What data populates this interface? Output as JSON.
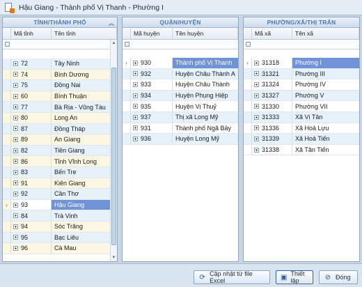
{
  "window": {
    "title": "Hậu Giang - Thành phố Vị Thanh - Phường I"
  },
  "provinces": {
    "title": "TỈNH/THÀNH PHỐ",
    "col_code": "Mã tỉnh",
    "col_name": "Tên tỉnh",
    "rows": [
      {
        "code": "72",
        "name": "Tây Ninh"
      },
      {
        "code": "74",
        "name": "Bình Dương"
      },
      {
        "code": "75",
        "name": "Đồng Nai"
      },
      {
        "code": "60",
        "name": "Bình Thuận"
      },
      {
        "code": "77",
        "name": "Bà Rịa - Vũng Tàu"
      },
      {
        "code": "80",
        "name": "Long An"
      },
      {
        "code": "87",
        "name": "Đồng Tháp"
      },
      {
        "code": "89",
        "name": "An Giang"
      },
      {
        "code": "82",
        "name": "Tiền Giang"
      },
      {
        "code": "86",
        "name": "Tỉnh  Vĩnh Long"
      },
      {
        "code": "83",
        "name": "Bến Tre"
      },
      {
        "code": "91",
        "name": "Kiên Giang"
      },
      {
        "code": "92",
        "name": "Cần Thơ"
      },
      {
        "code": "93",
        "name": "Hậu Giang"
      },
      {
        "code": "84",
        "name": "Trà Vinh"
      },
      {
        "code": "94",
        "name": "Sóc Trăng"
      },
      {
        "code": "95",
        "name": "Bạc Liêu"
      },
      {
        "code": "96",
        "name": "Cà Mau"
      }
    ]
  },
  "districts": {
    "title": "QUẬN/HUYỆN",
    "col_code": "Mã huyện",
    "col_name": "Tên huyện",
    "rows": [
      {
        "code": "930",
        "name": "Thành phố Vị Thanh"
      },
      {
        "code": "932",
        "name": "Huyện Châu Thành A"
      },
      {
        "code": "933",
        "name": "Huyện Châu Thành"
      },
      {
        "code": "934",
        "name": "Huyện Phụng Hiệp"
      },
      {
        "code": "935",
        "name": "Huyện Vị Thuỷ"
      },
      {
        "code": "937",
        "name": "Thị xã Long Mỹ"
      },
      {
        "code": "931",
        "name": "Thành phố Ngã Bảy"
      },
      {
        "code": "936",
        "name": "Huyện Long Mỹ"
      }
    ]
  },
  "wards": {
    "title": "PHƯỜNG/XÃ/THỊ TRẤN",
    "col_code": "Mã xã",
    "col_name": "Tên xã",
    "rows": [
      {
        "code": "31318",
        "name": "Phường I"
      },
      {
        "code": "31321",
        "name": "Phường III"
      },
      {
        "code": "31324",
        "name": "Phường IV"
      },
      {
        "code": "31327",
        "name": "Phường V"
      },
      {
        "code": "31330",
        "name": "Phường VII"
      },
      {
        "code": "31333",
        "name": "Xã Vị Tân"
      },
      {
        "code": "31336",
        "name": "Xã Hoả Lựu"
      },
      {
        "code": "31339",
        "name": "Xã Hoả Tiến"
      },
      {
        "code": "31338",
        "name": "Xã Tân Tiến"
      }
    ]
  },
  "buttons": {
    "update_excel": "Cập nhật từ file Excel",
    "setup": "Thiết lập",
    "close": "Đóng"
  },
  "icons": {
    "app": "document-icon",
    "excel": "refresh-icon",
    "setup": "settings-icon",
    "close": "prohibited-icon"
  }
}
